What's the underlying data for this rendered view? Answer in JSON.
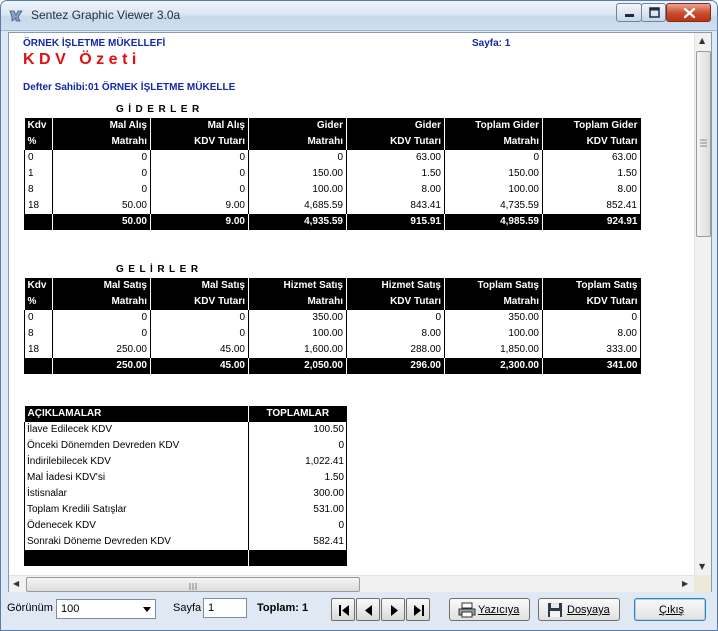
{
  "window": {
    "title": "Sentez Graphic Viewer 3.0a"
  },
  "report": {
    "company_name": "ÖRNEK İŞLETME MÜKELLEFİ",
    "page_label": "Sayfa:  1",
    "title": "KDV Özeti",
    "owner_line": "Defter Sahibi:01   ÖRNEK İŞLETME MÜKELLE",
    "expenses": {
      "section_title": "GİDERLER",
      "headers": [
        [
          "Kdv",
          "%"
        ],
        [
          "Mal Alış",
          "Matrahı"
        ],
        [
          "Mal Alış",
          "KDV Tutarı"
        ],
        [
          "Gider",
          "Matrahı"
        ],
        [
          "Gider",
          "KDV Tutarı"
        ],
        [
          "Toplam Gider",
          "Matrahı"
        ],
        [
          "Toplam Gider",
          "KDV Tutarı"
        ]
      ],
      "rows": [
        [
          "0",
          "0",
          "0",
          "0",
          "63.00",
          "0",
          "63.00"
        ],
        [
          "1",
          "0",
          "0",
          "150.00",
          "1.50",
          "150.00",
          "1.50"
        ],
        [
          "8",
          "0",
          "0",
          "100.00",
          "8.00",
          "100.00",
          "8.00"
        ],
        [
          "18",
          "50.00",
          "9.00",
          "4,685.59",
          "843.41",
          "4,735.59",
          "852.41"
        ]
      ],
      "totals": [
        "",
        "50.00",
        "9.00",
        "4,935.59",
        "915.91",
        "4,985.59",
        "924.91"
      ]
    },
    "income": {
      "section_title": "GELİRLER",
      "headers": [
        [
          "Kdv",
          "%"
        ],
        [
          "Mal Satış",
          "Matrahı"
        ],
        [
          "Mal Satış",
          "KDV Tutarı"
        ],
        [
          "Hizmet Satış",
          "Matrahı"
        ],
        [
          "Hizmet Satış",
          "KDV Tutarı"
        ],
        [
          "Toplam Satış",
          "Matrahı"
        ],
        [
          "Toplam Satış",
          "KDV Tutarı"
        ]
      ],
      "rows": [
        [
          "0",
          "0",
          "0",
          "350.00",
          "0",
          "350.00",
          "0"
        ],
        [
          "8",
          "0",
          "0",
          "100.00",
          "8.00",
          "100.00",
          "8.00"
        ],
        [
          "18",
          "250.00",
          "45.00",
          "1,600.00",
          "288.00",
          "1,850.00",
          "333.00"
        ]
      ],
      "totals": [
        "",
        "250.00",
        "45.00",
        "2,050.00",
        "296.00",
        "2,300.00",
        "341.00"
      ]
    },
    "summary": {
      "header_label": "AÇIKLAMALAR",
      "header_value": "TOPLAMLAR",
      "rows": [
        {
          "label": "İlave Edilecek KDV",
          "value": "100.50"
        },
        {
          "label": "Önceki Dönemden Devreden KDV",
          "value": "0"
        },
        {
          "label": "İndirilebilecek KDV",
          "value": "1,022.41"
        },
        {
          "label": "Mal İadesi KDV'si",
          "value": "1.50"
        },
        {
          "label": "İstisnalar",
          "value": "300.00"
        },
        {
          "label": "Toplam Kredili Satışlar",
          "value": "531.00"
        },
        {
          "label": "Ödenecek KDV",
          "value": "0"
        },
        {
          "label": "Sonraki Döneme Devreden KDV",
          "value": "582.41"
        }
      ]
    }
  },
  "toolbar": {
    "zoom_label": "Görünüm",
    "zoom_value": "100",
    "page_label": "Sayfa",
    "page_value": "1",
    "total_label": "Toplam:  1",
    "print_label": "Yazıcıya",
    "file_label": "Dosyaya",
    "exit_label": "Çıkış"
  },
  "colors": {
    "title_red": "#e01010",
    "header_blue": "#1428a8",
    "table_header": "#000000"
  },
  "icons": {
    "app": "app-icon",
    "minimize": "minimize-icon",
    "maximize": "maximize-icon",
    "close": "close-icon",
    "first_page": "first-page-icon",
    "prev_page": "previous-page-icon",
    "next_page": "next-page-icon",
    "last_page": "last-page-icon",
    "print": "printer-icon",
    "save": "floppy-disk-icon"
  }
}
